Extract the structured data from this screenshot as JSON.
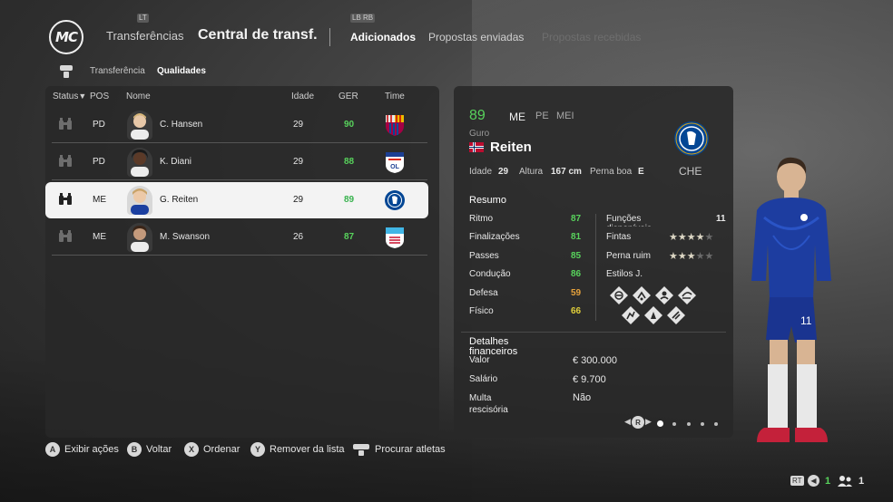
{
  "header": {
    "logo_text": "MC",
    "hint_left": "LT",
    "hint_right": "LB RB",
    "breadcrumb": "Transferências",
    "title": "Central de transf.",
    "tabs": [
      {
        "label": "Adicionados",
        "state": "active"
      },
      {
        "label": "Propostas enviadas",
        "state": "inactive"
      },
      {
        "label": "Propostas recebidas",
        "state": "disabled"
      }
    ]
  },
  "subtabs": [
    {
      "label": "Transferência",
      "state": "inactive"
    },
    {
      "label": "Qualidades",
      "state": "active"
    }
  ],
  "table": {
    "columns": {
      "status": "Status",
      "pos": "POS",
      "name": "Nome",
      "age": "Idade",
      "ovr": "GER",
      "club": "Time"
    },
    "sort_indicator": "▼",
    "rows": [
      {
        "pos": "PD",
        "name": "C. Hansen",
        "age": "29",
        "ovr": "90",
        "club": "barcelona-crest"
      },
      {
        "pos": "PD",
        "name": "K. Diani",
        "age": "29",
        "ovr": "88",
        "club": "lyon-crest"
      },
      {
        "pos": "ME",
        "name": "G. Reiten",
        "age": "29",
        "ovr": "89",
        "club": "chelsea-crest"
      },
      {
        "pos": "ME",
        "name": "M. Swanson",
        "age": "26",
        "ovr": "87",
        "club": "red-stars-crest"
      }
    ],
    "selected_index": 2
  },
  "details": {
    "ovr": "89",
    "positions": [
      "ME",
      "PE",
      "MEI"
    ],
    "first_name": "Guro",
    "last_name": "Reiten",
    "nationality": "norway-flag",
    "club_code": "CHE",
    "age_label": "Idade",
    "age": "29",
    "height_label": "Altura",
    "height": "167 cm",
    "foot_label": "Perna boa",
    "foot": "E",
    "summary_title": "Resumo",
    "stats": [
      {
        "label": "Ritmo",
        "value": "87",
        "color": "green"
      },
      {
        "label": "Finalizações",
        "value": "81",
        "color": "green"
      },
      {
        "label": "Passes",
        "value": "85",
        "color": "green"
      },
      {
        "label": "Condução",
        "value": "86",
        "color": "green"
      },
      {
        "label": "Defesa",
        "value": "59",
        "color": "orange"
      },
      {
        "label": "Físico",
        "value": "66",
        "color": "yellow"
      }
    ],
    "extra": {
      "functions_label": "Funções disponíveis",
      "functions_value": "11",
      "skill_moves_label": "Fintas",
      "skill_moves_stars": 4,
      "weak_foot_label": "Perna ruim",
      "weak_foot_stars": 3,
      "playstyles_label": "Estilos J."
    },
    "finance_title": "Detalhes financeiros",
    "finance": [
      {
        "label": "Valor",
        "value": "€ 300.000"
      },
      {
        "label": "Salário",
        "value": "€ 9.700"
      },
      {
        "label": "Multa rescisória",
        "value": "Não"
      }
    ],
    "pager": {
      "button": "R",
      "pages": 5,
      "current": 1
    }
  },
  "footer": {
    "hints": [
      {
        "button": "A",
        "label": "Exibir ações"
      },
      {
        "button": "B",
        "label": "Voltar"
      },
      {
        "button": "X",
        "label": "Ordenar"
      },
      {
        "button": "Y",
        "label": "Remover da lista"
      },
      {
        "button": "share",
        "label": "Procurar atletas"
      }
    ],
    "rt_label": "RT",
    "count_a": "1",
    "count_b": "1"
  },
  "colors": {
    "green": "#58d35c",
    "orange": "#e6a23c",
    "yellow": "#e0cf3a",
    "panel": "#2b2b2b"
  }
}
